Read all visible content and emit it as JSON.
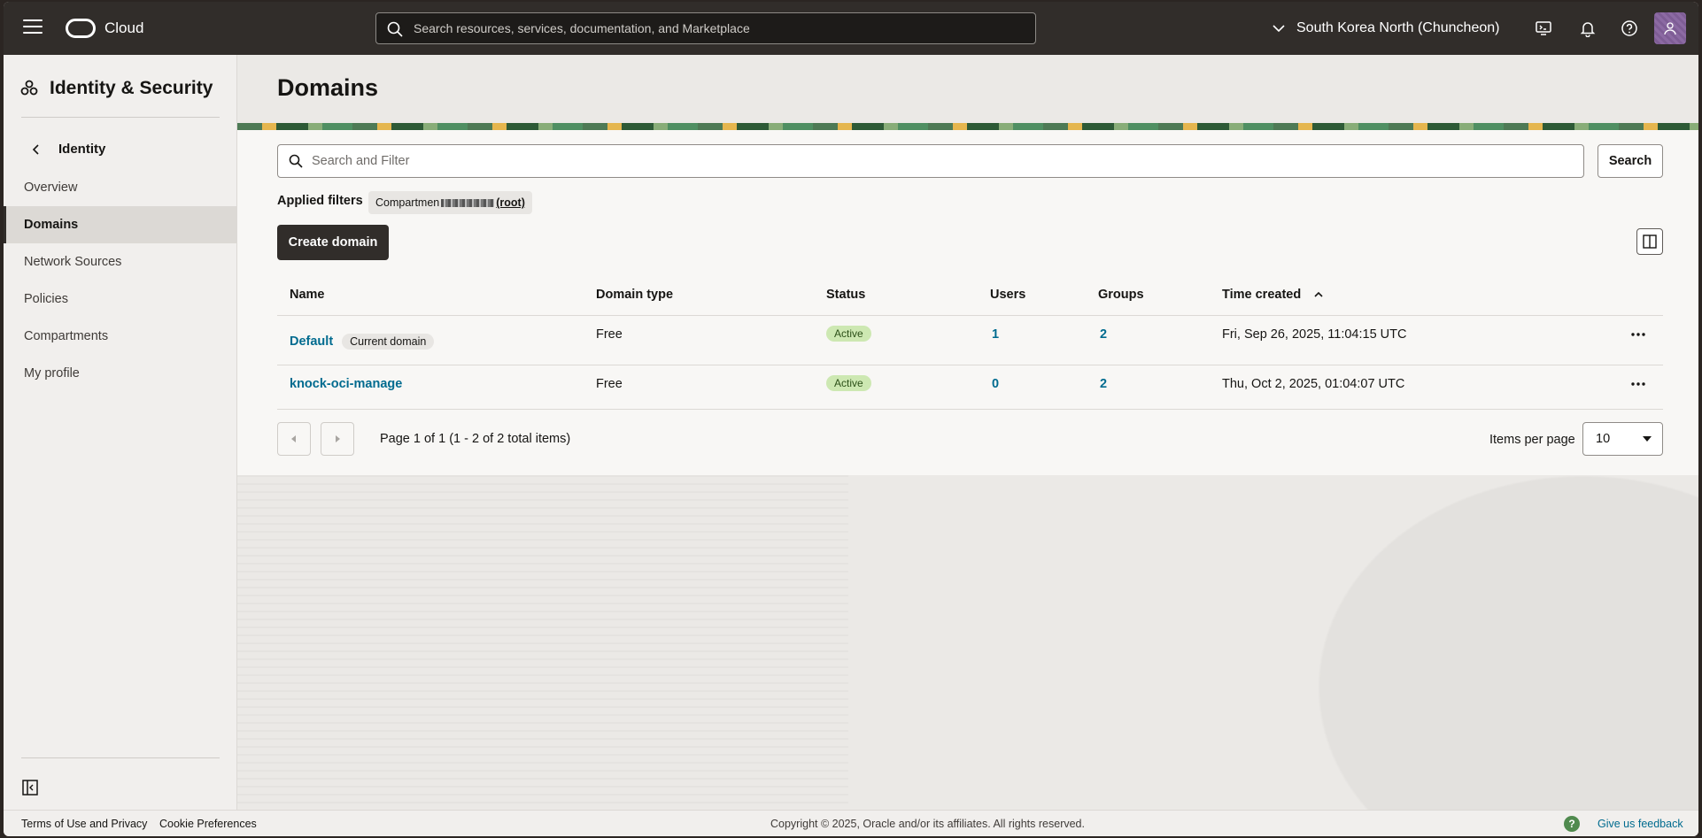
{
  "header": {
    "brand": "Cloud",
    "search_placeholder": "Search resources, services, documentation, and Marketplace",
    "region": "South Korea North (Chuncheon)"
  },
  "sidebar": {
    "title": "Identity & Security",
    "back_label": "Identity",
    "items": [
      {
        "label": "Overview"
      },
      {
        "label": "Domains"
      },
      {
        "label": "Network Sources"
      },
      {
        "label": "Policies"
      },
      {
        "label": "Compartments"
      },
      {
        "label": "My profile"
      }
    ]
  },
  "main": {
    "title": "Domains",
    "filter_placeholder": "Search and Filter",
    "search_button": "Search",
    "applied_filters_label": "Applied filters",
    "filter_chip": {
      "prefix": "Compartmen",
      "root": "(root)"
    },
    "create_button": "Create domain"
  },
  "table": {
    "columns": [
      "Name",
      "Domain type",
      "Status",
      "Users",
      "Groups",
      "Time created"
    ],
    "rows": [
      {
        "name": "Default",
        "tag": "Current domain",
        "type": "Free",
        "status": "Active",
        "users": "1",
        "groups": "2",
        "created": "Fri, Sep 26, 2025, 11:04:15 UTC"
      },
      {
        "name": "knock-oci-manage",
        "tag": "",
        "type": "Free",
        "status": "Active",
        "users": "0",
        "groups": "2",
        "created": "Thu, Oct 2, 2025, 01:04:07 UTC"
      }
    ]
  },
  "pagination": {
    "text": "Page 1 of 1 (1 - 2 of 2 total items)",
    "items_per_page_label": "Items per page",
    "items_per_page_value": "10"
  },
  "footer": {
    "terms": "Terms of Use and Privacy",
    "cookies": "Cookie Preferences",
    "copyright": "Copyright © 2025, Oracle and/or its affiliates. All rights reserved.",
    "feedback": "Give us feedback",
    "feedback_icon": "?"
  },
  "icons": {
    "hamburger": "hamburger-icon",
    "search": "search-icon",
    "region_chevron": "chevron-down-icon",
    "cloud_shell": "cloud-shell-icon",
    "notifications": "bell-icon",
    "help": "help-icon",
    "profile": "user-icon"
  },
  "colors": {
    "header_bg": "#312d2a",
    "link": "#006b8f",
    "active_badge": "#cde8b2",
    "primary_button": "#312d2a"
  }
}
